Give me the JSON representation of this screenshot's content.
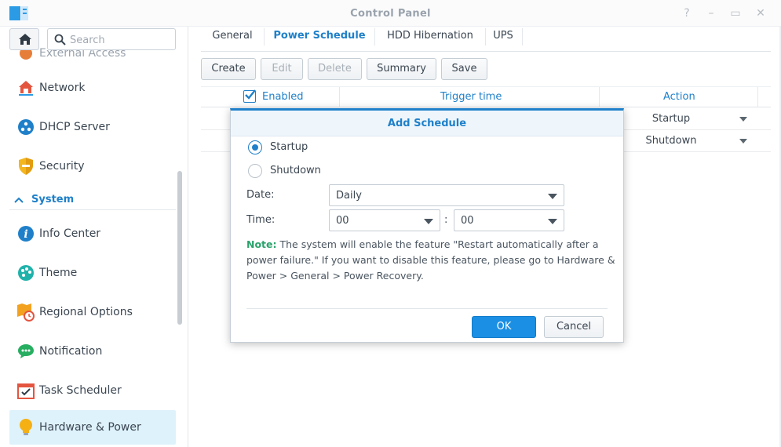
{
  "window": {
    "title": "Control Panel",
    "controls": {
      "help": "?",
      "minimize": "–",
      "maximize": "▭",
      "close": "✕"
    }
  },
  "sidebar": {
    "search_placeholder": "Search",
    "partial_item": "External Access",
    "items_top": [
      {
        "label": "Network",
        "icon": "network-icon"
      },
      {
        "label": "DHCP Server",
        "icon": "dhcp-icon"
      },
      {
        "label": "Security",
        "icon": "shield-icon"
      }
    ],
    "section": {
      "label": "System",
      "icon": "chevron-up-icon"
    },
    "items_system": [
      {
        "label": "Info Center",
        "icon": "info-icon"
      },
      {
        "label": "Theme",
        "icon": "palette-icon"
      },
      {
        "label": "Regional Options",
        "icon": "map-clock-icon"
      },
      {
        "label": "Notification",
        "icon": "chat-bubble-icon"
      },
      {
        "label": "Task Scheduler",
        "icon": "calendar-check-icon"
      },
      {
        "label": "Hardware & Power",
        "icon": "lightbulb-icon",
        "active": true
      }
    ]
  },
  "main": {
    "tabs": [
      {
        "label": "General"
      },
      {
        "label": "Power Schedule",
        "active": true
      },
      {
        "label": "HDD Hibernation"
      },
      {
        "label": "UPS"
      }
    ],
    "toolbar": {
      "create": "Create",
      "edit": "Edit",
      "delete": "Delete",
      "summary": "Summary",
      "save": "Save"
    },
    "grid": {
      "columns": [
        "Enabled",
        "Trigger time",
        "Action"
      ],
      "rows": [
        {
          "action": "Startup"
        },
        {
          "action": "Shutdown"
        }
      ]
    }
  },
  "dialog": {
    "title": "Add Schedule",
    "radio_startup": "Startup",
    "radio_shutdown": "Shutdown",
    "selected": "Startup",
    "date_label": "Date:",
    "date_value": "Daily",
    "time_label": "Time:",
    "hour_value": "00",
    "minute_value": "00",
    "colon": ":",
    "note_label": "Note:",
    "note_text": "The system will enable the feature \"Restart automatically after a power failure.\" If you want to disable this feature, please go to Hardware & Power > General > Power Recovery.",
    "ok": "OK",
    "cancel": "Cancel"
  },
  "colors": {
    "accent": "#1f80c9",
    "active_bg": "#def2fc",
    "ok_button": "#1a8fe3",
    "note_label": "#2aa36b"
  }
}
